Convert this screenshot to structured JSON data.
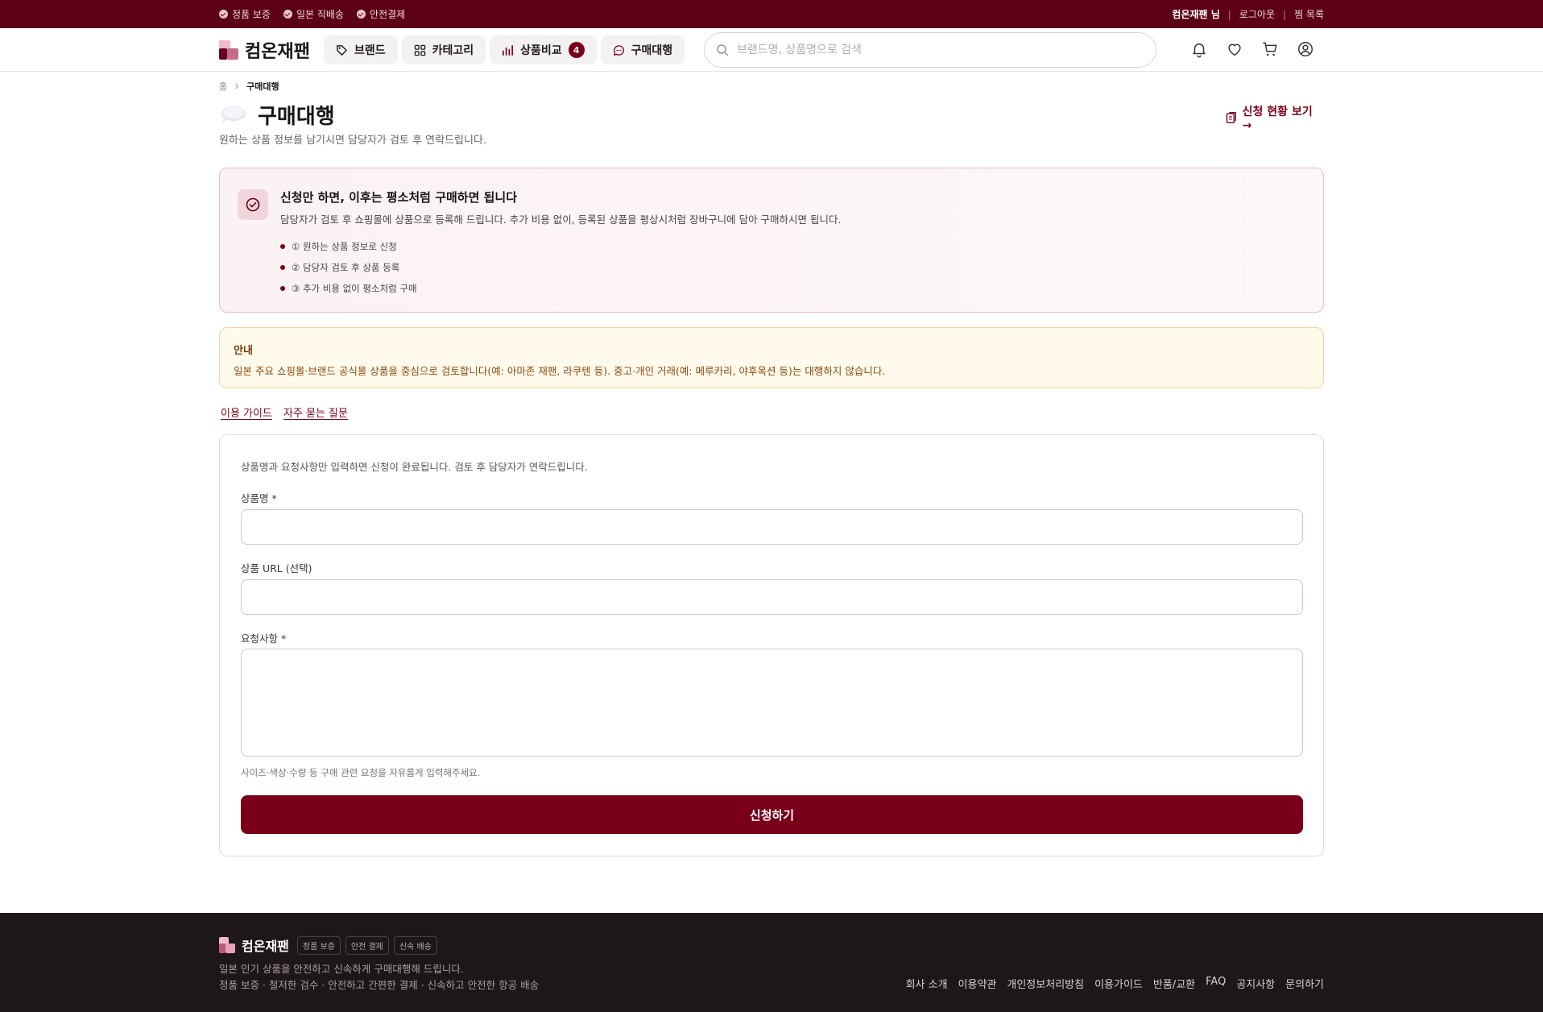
{
  "topbar": {
    "badges": [
      "정품 보증",
      "일본 직배송",
      "안전결제"
    ],
    "user": "컴온재팬 님",
    "logout": "로그아웃",
    "wishlist": "찜 목록"
  },
  "header": {
    "logo": "컴온재팬",
    "nav": [
      {
        "label": "브랜드",
        "icon": "tag-icon"
      },
      {
        "label": "카테고리",
        "icon": "grid-icon"
      },
      {
        "label": "상품비교",
        "icon": "bar-chart-icon",
        "badge": "4"
      },
      {
        "label": "구매대행",
        "icon": "chat-bubble-icon"
      }
    ],
    "search_placeholder": "브랜드명, 상품명으로 검색",
    "icons": [
      "bell-icon",
      "heart-icon",
      "cart-icon",
      "user-icon"
    ]
  },
  "breadcrumb": {
    "home": "홈",
    "current": "구매대행"
  },
  "page": {
    "title": "구매대행",
    "subtitle": "원하는 상품 정보를 남기시면 담당자가 검토 후 연락드립니다.",
    "status_link": "신청 현황 보기 →"
  },
  "info": {
    "title": "신청만 하면, 이후는 평소처럼 구매하면 됩니다",
    "desc": "담당자가 검토 후 쇼핑몰에 상품으로 등록해 드립니다. 추가 비용 없이, 등록된 상품을 평상시처럼 장바구니에 담아 구매하시면 됩니다.",
    "steps": [
      "① 원하는 상품 정보로 신청",
      "② 담당자 검토 후 상품 등록",
      "③ 추가 비용 없이 평소처럼 구매"
    ]
  },
  "notice": {
    "title": "안내",
    "text": "일본 주요 쇼핑몰·브랜드 공식몰 상품을 중심으로 검토합니다(예: 아마존 재팬, 라쿠텐 등). 중고·개인 거래(예: 메루카리, 야후옥션 등)는 대행하지 않습니다."
  },
  "links": {
    "guide": "이용 가이드",
    "faq": "자주 묻는 질문"
  },
  "form": {
    "intro": "상품명과 요청사항만 입력하면 신청이 완료됩니다. 검토 후 담당자가 연락드립니다.",
    "name_label": "상품명 *",
    "name_value": "",
    "url_label": "상품 URL (선택)",
    "url_value": "",
    "request_label": "요청사항 *",
    "request_value": "",
    "hint": "사이즈·색상·수량 등 구매 관련 요청을 자유롭게 입력해주세요.",
    "submit": "신청하기"
  },
  "footer": {
    "logo": "컴온재팬",
    "tags": [
      "정품 보증",
      "안전 결제",
      "신속 배송"
    ],
    "desc1": "일본 인기 상품을 안전하고 신속하게 구매대행해 드립니다.",
    "desc2": "정품 보증 · 철저한 검수 · 안전하고 간편한 결제 · 신속하고 안전한 항공 배송",
    "links": [
      "회사 소개",
      "이용약관",
      "개인정보처리방침",
      "이용가이드",
      "반품/교환",
      "FAQ",
      "공지사항",
      "문의하기"
    ]
  },
  "colors": {
    "brand": "#7a0019",
    "topbar": "#5c0016",
    "footer": "#1e1719",
    "notice_bg": "#fffaeb"
  }
}
